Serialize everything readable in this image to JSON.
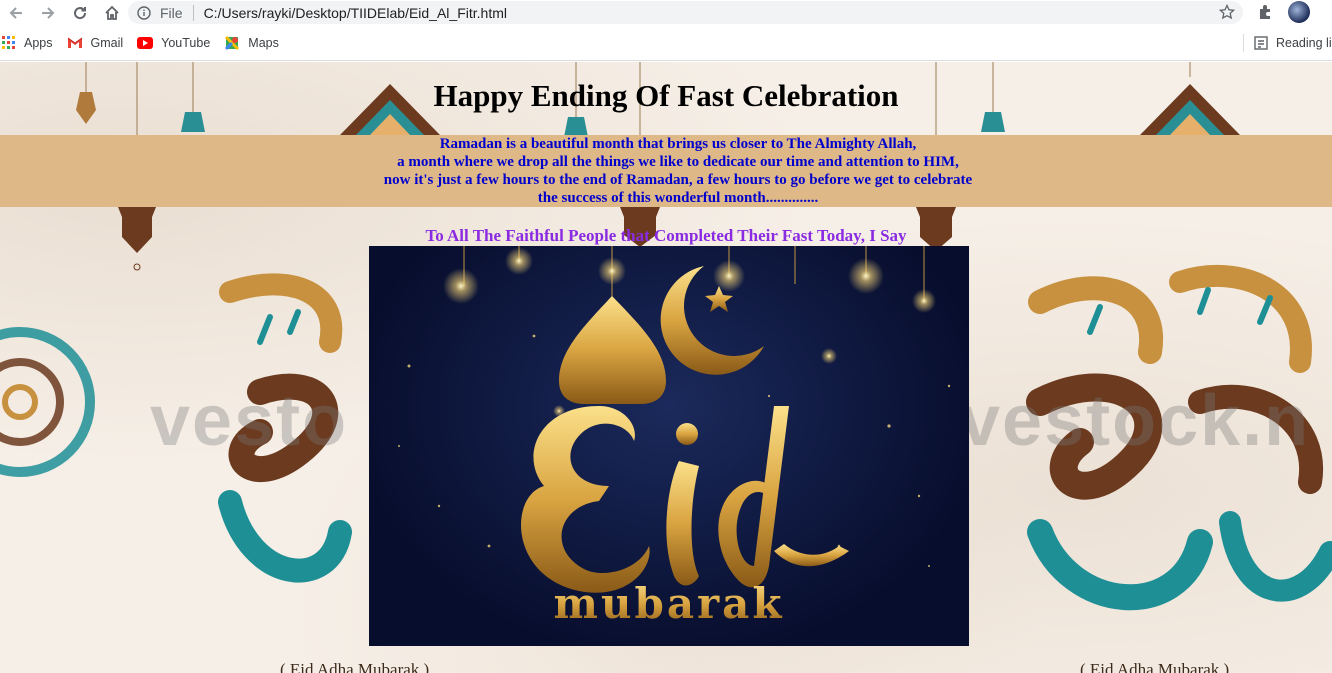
{
  "browser": {
    "address": "C:/Users/rayki/Desktop/TIIDElab/Eid_Al_Fitr.html",
    "scheme_label": "File",
    "bookmarks": [
      {
        "label": "Apps",
        "icon": "apps-grid-icon"
      },
      {
        "label": "Gmail",
        "icon": "gmail-icon"
      },
      {
        "label": "YouTube",
        "icon": "youtube-icon"
      },
      {
        "label": "Maps",
        "icon": "maps-icon"
      }
    ],
    "reading_list_label": "Reading lis"
  },
  "page": {
    "title": "Happy Ending Of Fast Celebration",
    "paragraph_lines": [
      "Ramadan is a beautiful month that brings us closer to The Almighty Allah,",
      "a month where we drop all the things we like to dedicate our time and attention to HIM,",
      "now it's just a few hours to the end of Ramadan, a few hours to go before we get to celebrate",
      "the success of this wonderful month.............."
    ],
    "subheading": "To All The Faithful People that Completed Their Fast Today, I Say",
    "image": {
      "word": "Eid",
      "tagline": "mubarak"
    },
    "watermark": "vestock.n"
  },
  "colors": {
    "band": "#deb887",
    "paragraph": "#0000cd",
    "subheading": "#8a2be2",
    "teal": "#1f8f96",
    "brown": "#6b3a1f",
    "gold": "#c8913f"
  }
}
